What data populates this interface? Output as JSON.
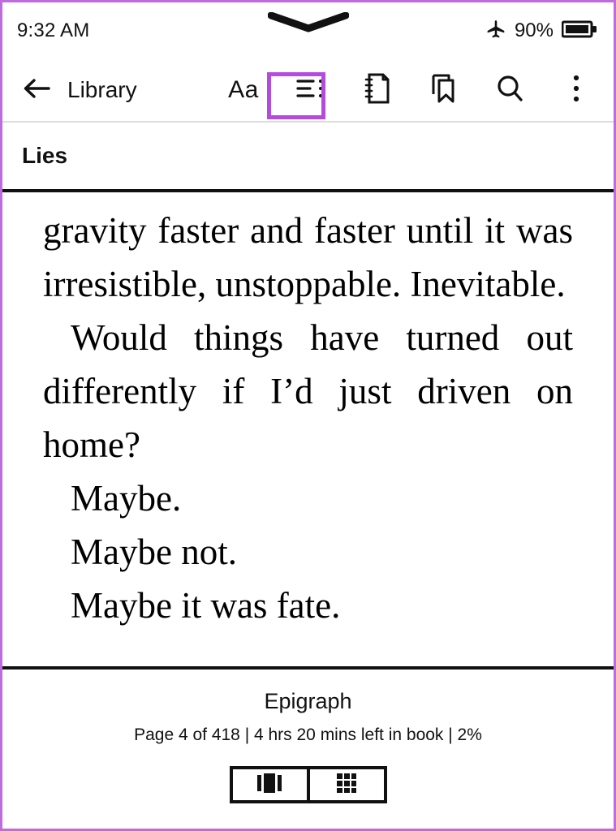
{
  "status_bar": {
    "time": "9:32 AM",
    "battery_percent": "90%",
    "airplane_icon": "airplane-mode-icon",
    "battery_icon": "battery-icon",
    "notch_icon": "chevron-notch-icon"
  },
  "toolbar": {
    "back_icon": "back-arrow-icon",
    "back_label": "Library",
    "actions": [
      {
        "name": "font-settings",
        "label": "Aa",
        "icon": "text-size-icon",
        "highlighted": true
      },
      {
        "name": "table-of-contents",
        "label": "",
        "icon": "list-icon",
        "highlighted": false
      },
      {
        "name": "notebook",
        "label": "",
        "icon": "notebook-icon",
        "highlighted": false
      },
      {
        "name": "bookmarks",
        "label": "",
        "icon": "bookmark-icon",
        "highlighted": false
      },
      {
        "name": "search",
        "label": "",
        "icon": "search-icon",
        "highlighted": false
      },
      {
        "name": "more-options",
        "label": "",
        "icon": "more-vertical-icon",
        "highlighted": false
      }
    ],
    "annotation_color": "#b44be0"
  },
  "book_header": {
    "title": "Lies"
  },
  "reader": {
    "paragraphs": [
      {
        "text": "gravity faster and faster until it was irresistible, unstoppable. Inevitable.",
        "indent": false
      },
      {
        "text": "Would things have turned out differently if I’d just driven on home?",
        "indent": true
      },
      {
        "text": "Maybe.",
        "indent": true
      },
      {
        "text": "Maybe not.",
        "indent": true
      },
      {
        "text": "Maybe it was fate.",
        "indent": true
      }
    ]
  },
  "footer": {
    "chapter": "Epigraph",
    "progress": "Page 4 of 418 | 4 hrs 20 mins left in book | 2%",
    "view_toggle": [
      {
        "name": "page-view",
        "icon": "single-page-view-icon"
      },
      {
        "name": "grid-view",
        "icon": "grid-view-icon"
      }
    ]
  }
}
